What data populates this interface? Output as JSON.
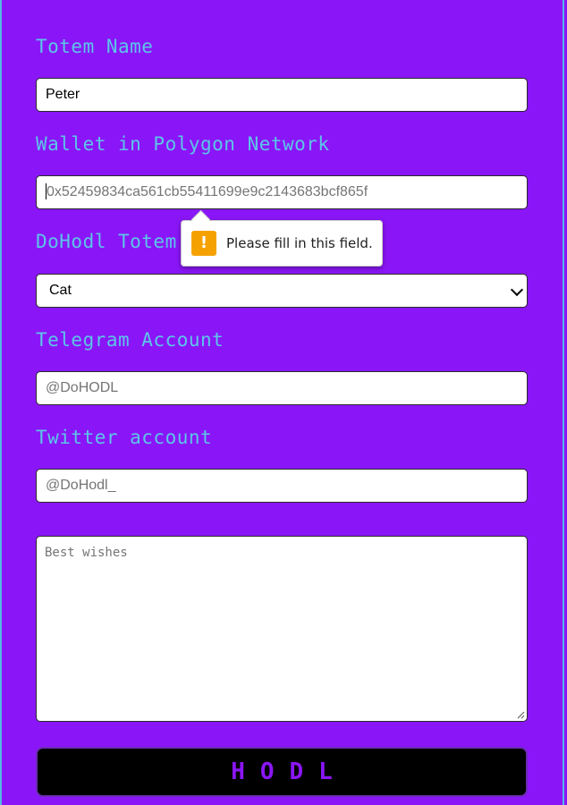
{
  "form": {
    "totem_name": {
      "label": "Totem Name",
      "value": "Peter"
    },
    "wallet": {
      "label": "Wallet in Polygon Network",
      "placeholder": "0x52459834ca561cb55411699e9c2143683bcf865f"
    },
    "totem": {
      "label": "DoHodl Totem",
      "selected": "Cat"
    },
    "telegram": {
      "label": "Telegram Account",
      "placeholder": "@DoHODL"
    },
    "twitter": {
      "label": "Twitter account",
      "placeholder": "@DoHodl_"
    },
    "message": {
      "placeholder": "Best wishes"
    },
    "submit_label": "HODL"
  },
  "validation_tooltip": {
    "icon": "warning-icon",
    "text": "Please fill in this field."
  },
  "colors": {
    "background": "#8a16f7",
    "label": "#5cc6e8",
    "button_bg": "#000000",
    "button_text": "#8a16f7",
    "warning": "#f5a200"
  }
}
